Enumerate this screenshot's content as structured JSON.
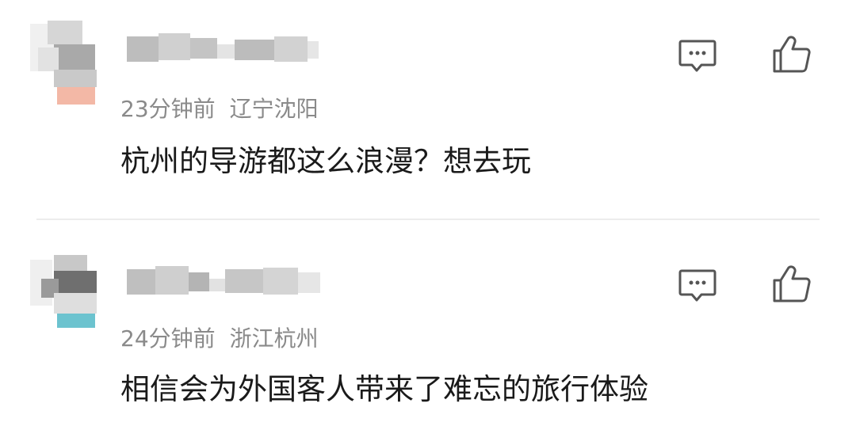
{
  "comments": [
    {
      "time": "23分钟前",
      "location": "辽宁沈阳",
      "text": "杭州的导游都这么浪漫？想去玩",
      "icons": {
        "reply": "comment-bubble-icon",
        "like": "thumbs-up-icon"
      }
    },
    {
      "time": "24分钟前",
      "location": "浙江杭州",
      "text": "相信会为外国客人带来了难忘的旅行体验",
      "icons": {
        "reply": "comment-bubble-icon",
        "like": "thumbs-up-icon"
      }
    }
  ],
  "colors": {
    "meta_text": "#8a8a8a",
    "content_text": "#1a1a1a",
    "icon_stroke": "#555555",
    "divider": "#ececec"
  }
}
